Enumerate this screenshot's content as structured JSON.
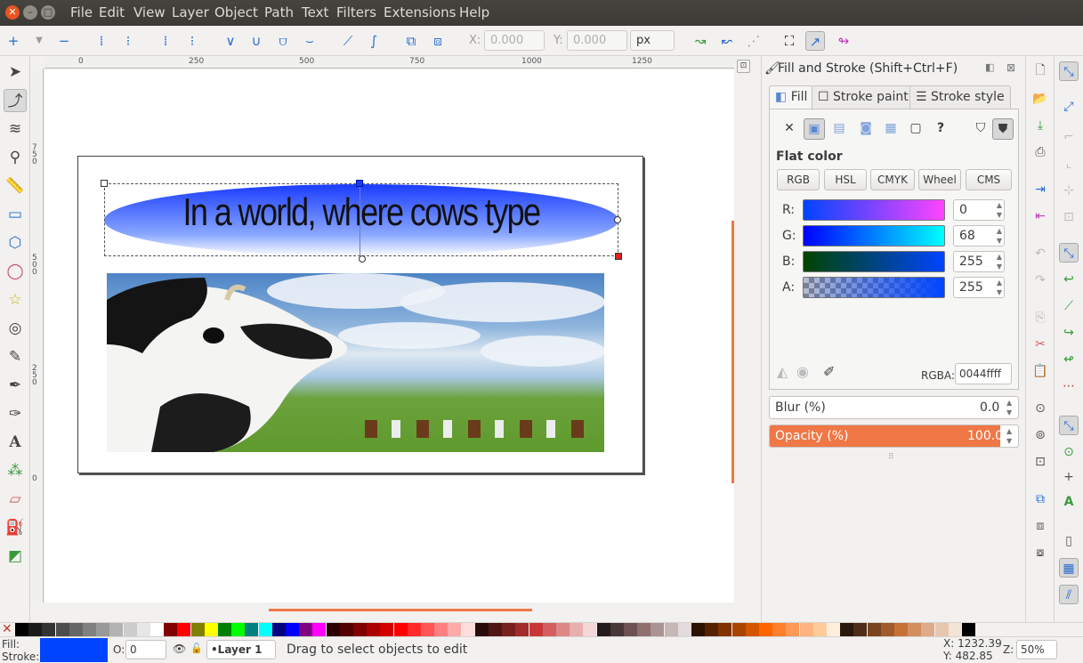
{
  "menubar": {
    "items": [
      "File",
      "Edit",
      "View",
      "Layer",
      "Object",
      "Path",
      "Text",
      "Filters",
      "Extensions",
      "Help"
    ]
  },
  "toolbar": {
    "x_label": "X:",
    "x_value": "0.000",
    "y_label": "Y:",
    "y_value": "0.000",
    "unit": "px"
  },
  "ruler": {
    "h_ticks": [
      "0",
      "250",
      "500",
      "750",
      "1000",
      "1250"
    ],
    "v_ticks": [
      "750",
      "500",
      "250",
      "0"
    ]
  },
  "canvas": {
    "headline": "In a world, where cows type"
  },
  "dock": {
    "title": "Fill and Stroke (Shift+Ctrl+F)",
    "tabs": [
      {
        "label": "Fill"
      },
      {
        "label": "Stroke paint"
      },
      {
        "label": "Stroke style"
      }
    ],
    "paint_type": "Flat color",
    "modes": [
      "RGB",
      "HSL",
      "CMYK",
      "Wheel",
      "CMS"
    ],
    "channels": [
      {
        "label": "R:",
        "value": "0"
      },
      {
        "label": "G:",
        "value": "68"
      },
      {
        "label": "B:",
        "value": "255"
      },
      {
        "label": "A:",
        "value": "255"
      }
    ],
    "rgba_label": "RGBA:",
    "rgba_value": "0044ffff",
    "blur_label": "Blur (%)",
    "blur_value": "0.0",
    "opacity_label": "Opacity (%)",
    "opacity_value": "100.0"
  },
  "status": {
    "fill_label": "Fill:",
    "stroke_label": "Stroke:",
    "o_label": "O:",
    "o_value": "0",
    "layer": "•Layer 1",
    "message": "Drag to select objects to edit",
    "x_coord": "X: 1232.39",
    "y_coord": "Y:  482.85",
    "z_label": "Z:",
    "zoom": "50%"
  },
  "colors": {
    "accent": "#f07746",
    "fill": "#0044ff"
  }
}
